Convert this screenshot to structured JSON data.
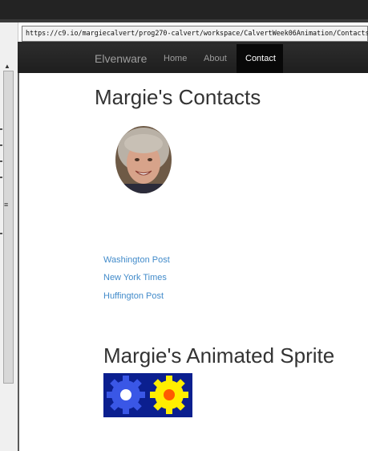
{
  "browser": {
    "url": "https://c9.io/margiecalvert/prog270-calvert/workspace/CalvertWeek06Animation/Contacts"
  },
  "navbar": {
    "brand": "Elvenware",
    "links": [
      {
        "label": "Home"
      },
      {
        "label": "About"
      },
      {
        "label": "Contact",
        "active": true
      }
    ]
  },
  "page": {
    "title": "Margie's Contacts",
    "news_links": [
      "Washington Post",
      "New York Times",
      "Huffington Post"
    ],
    "sprite_title": "Margie's Animated Sprite"
  },
  "colors": {
    "link": "#428bca",
    "navbar": "#222222",
    "sprite_bg": "#0b1f8f",
    "gear_left": "#3a57e6",
    "gear_right": "#ffee00"
  }
}
